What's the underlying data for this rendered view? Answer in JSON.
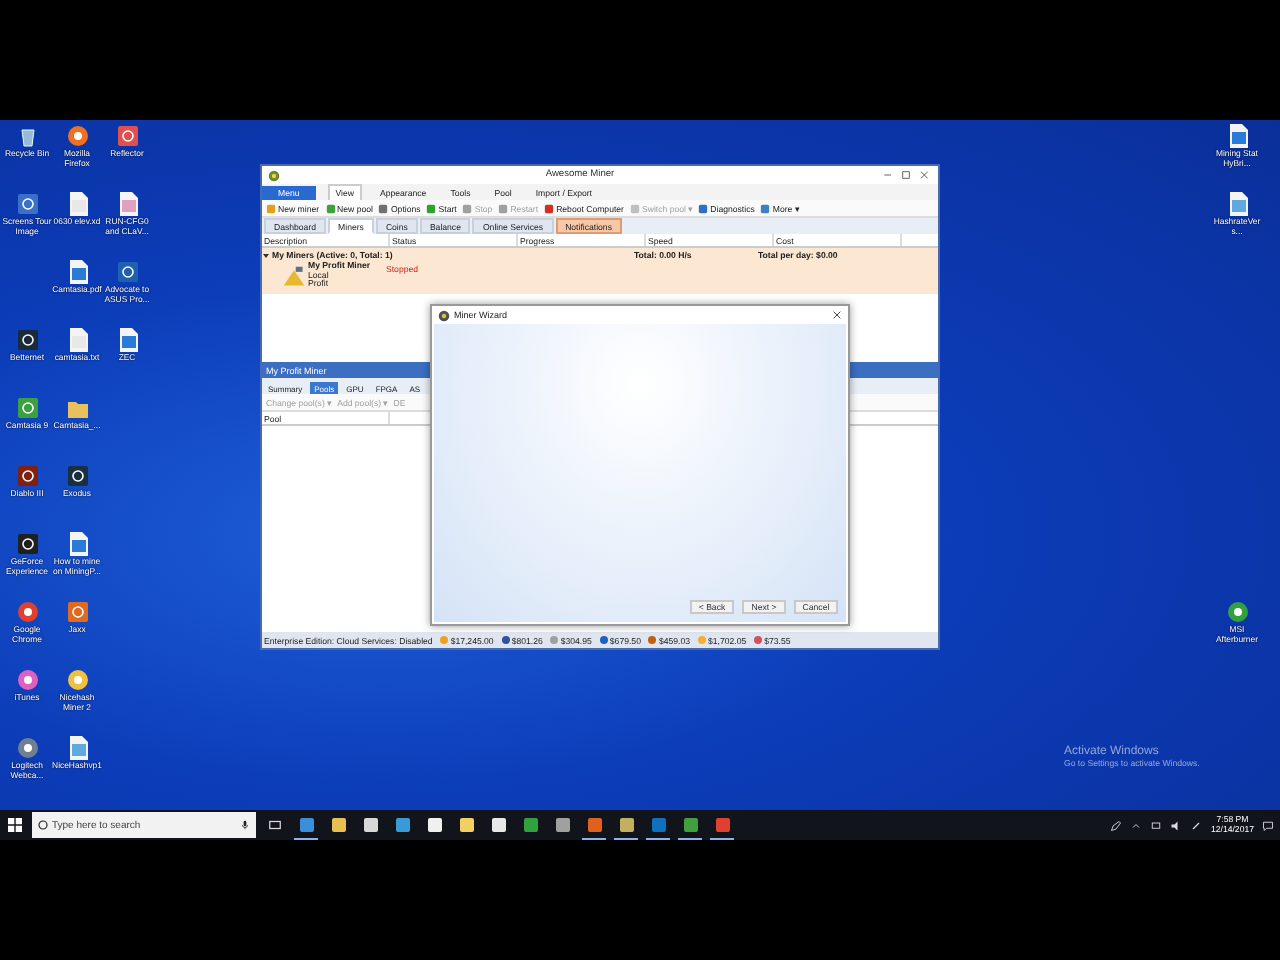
{
  "desktop": {
    "columns": [
      [
        {
          "label": "Recycle Bin",
          "kind": "bin",
          "color": "#9ab8d8"
        },
        {
          "label": "Screens Tour Image",
          "kind": "tile",
          "color": "#3a70c8"
        },
        {
          "label": "Betternet",
          "kind": "tile",
          "color": "#1a2a3a"
        },
        {
          "label": "Camtasia 9",
          "kind": "tile",
          "color": "#3aa040"
        },
        {
          "label": "Diablo III",
          "kind": "tile",
          "color": "#802010"
        },
        {
          "label": "GeForce Experience",
          "kind": "tile",
          "color": "#202020"
        },
        {
          "label": "Google Chrome",
          "kind": "globe",
          "color": "#e04030"
        },
        {
          "label": "iTunes",
          "kind": "globe",
          "color": "#e060c0"
        },
        {
          "label": "Logitech Webca...",
          "kind": "globe",
          "color": "#708090"
        }
      ],
      [
        {
          "label": "Mozilla Firefox",
          "kind": "globe",
          "color": "#f07020"
        },
        {
          "label": "0630 elev.xd",
          "kind": "page",
          "color": "#e8e8e8"
        },
        {
          "label": "Camtasia.pdf",
          "kind": "page",
          "color": "#2a7ad8"
        },
        {
          "label": "camtasia.txt",
          "kind": "page",
          "color": "#e8e8e8"
        },
        {
          "label": "Camtasia_...",
          "kind": "folder",
          "color": "#e8c060"
        },
        {
          "label": "Exodus",
          "kind": "tile",
          "color": "#183040"
        },
        {
          "label": "How to mine on MiningP...",
          "kind": "page",
          "color": "#2a7ad8"
        },
        {
          "label": "Jaxx",
          "kind": "tile",
          "color": "#e06a20"
        },
        {
          "label": "Nicehash Miner 2",
          "kind": "globe",
          "color": "#f0c040"
        },
        {
          "label": "NiceHashvp1",
          "kind": "page",
          "color": "#60a8e0"
        }
      ],
      [
        {
          "label": "Reflector",
          "kind": "tile",
          "color": "#e05050"
        },
        {
          "label": "RUN-CFG0 and CLaV...",
          "kind": "page",
          "color": "#e0a0c0"
        },
        {
          "label": "Advocate to ASUS Pro...",
          "kind": "tile",
          "color": "#2060b0"
        },
        {
          "label": "ZEC",
          "kind": "page",
          "color": "#2a7ad8"
        }
      ]
    ],
    "right_icons": [
      {
        "label": "Mining Stat HyBri...",
        "kind": "page",
        "color": "#2a7ad8"
      },
      {
        "label": "HashrateVers...",
        "kind": "page",
        "color": "#60a8e0"
      },
      {
        "label": "MSI Afterburner",
        "kind": "globe",
        "color": "#30a040"
      }
    ],
    "activation_notice": {
      "title": "Activate Windows",
      "text": "Go to Settings to activate Windows."
    }
  },
  "app_window": {
    "title": "Awesome Miner",
    "menu_button": "Menu",
    "ribbon_tabs": [
      {
        "label": "View",
        "selected": true
      },
      {
        "label": "Appearance",
        "selected": false
      },
      {
        "label": "Tools",
        "selected": false
      },
      {
        "label": "Pool",
        "selected": false
      },
      {
        "label": "Import / Export",
        "selected": false
      }
    ],
    "toolbar": [
      {
        "label": "New miner",
        "disabled": false,
        "color": "#e0a020"
      },
      {
        "label": "New pool",
        "disabled": false,
        "color": "#40a040"
      },
      {
        "label": "Options",
        "disabled": false,
        "color": "#707070"
      },
      {
        "label": "Start",
        "disabled": false,
        "color": "#30a030"
      },
      {
        "label": "Stop",
        "disabled": true,
        "color": "#a0a0a0"
      },
      {
        "label": "Restart",
        "disabled": true,
        "color": "#a0a0a0"
      },
      {
        "label": "Reboot Computer",
        "disabled": false,
        "color": "#d03020"
      },
      {
        "label": "Switch pool ▾",
        "disabled": true,
        "color": "#c0c0c0"
      },
      {
        "label": "Diagnostics",
        "disabled": false,
        "color": "#3070c0"
      },
      {
        "label": "More ▾",
        "disabled": false,
        "color": "#4080c0"
      }
    ],
    "tabs": [
      {
        "label": "Dashboard",
        "selected": false,
        "alert": false
      },
      {
        "label": "Miners",
        "selected": true,
        "alert": false
      },
      {
        "label": "Coins",
        "selected": false,
        "alert": false
      },
      {
        "label": "Balance",
        "selected": false,
        "alert": false
      },
      {
        "label": "Online Services",
        "selected": false,
        "alert": false
      },
      {
        "label": "Notifications",
        "selected": false,
        "alert": true
      }
    ],
    "columns": [
      "Description",
      "Status",
      "Progress",
      "Speed",
      "Cost"
    ],
    "group": {
      "expanded": true,
      "title": "My Miners (Active: 0, Total: 1)",
      "speed": "Total: 0.00 H/s",
      "cost": "Total per day: $0.00"
    },
    "miners": [
      {
        "name": "My Profit Miner",
        "lines": [
          "Local",
          "Profit"
        ],
        "status": "Stopped"
      }
    ],
    "detail": {
      "title": "My Profit Miner",
      "tabs": [
        {
          "label": "Summary",
          "selected": false
        },
        {
          "label": "Pools",
          "selected": true
        },
        {
          "label": "GPU",
          "selected": false
        },
        {
          "label": "FPGA",
          "selected": false
        },
        {
          "label": "AS",
          "selected": false
        }
      ],
      "toolbar": [
        {
          "label": "Change pool(s) ▾",
          "disabled": true
        },
        {
          "label": "Add pool(s) ▾",
          "disabled": true
        },
        {
          "label": "DE",
          "disabled": true
        }
      ],
      "columns": [
        "Pool"
      ]
    },
    "status_bar": {
      "edition": "Enterprise Edition: Cloud Services: Disabled",
      "prices": [
        {
          "value": "$17,245.00",
          "color": "#f0a020"
        },
        {
          "value": "$801.26",
          "color": "#3050a0"
        },
        {
          "value": "$304.95",
          "color": "#a0a0a0"
        },
        {
          "value": "$679.50",
          "color": "#2060c0"
        },
        {
          "value": "$459.03",
          "color": "#c06010"
        },
        {
          "value": "$1,702.05",
          "color": "#f0b030"
        },
        {
          "value": "$73.55",
          "color": "#d05060"
        }
      ]
    }
  },
  "wizard": {
    "title": "Miner Wizard",
    "buttons": [
      "< Back",
      "Next >",
      "Cancel"
    ]
  },
  "taskbar": {
    "search": {
      "placeholder": "Type here to search"
    },
    "apps": [
      {
        "color": "#3a8fd8",
        "running": true
      },
      {
        "color": "#e8c050",
        "running": false
      },
      {
        "color": "#d8d8d8",
        "running": false
      },
      {
        "color": "#3a9ad8",
        "running": false
      },
      {
        "color": "#f0f0f0",
        "running": false
      },
      {
        "color": "#f0d060",
        "running": false
      },
      {
        "color": "#e8e8e8",
        "running": false
      },
      {
        "color": "#30a040",
        "running": false
      },
      {
        "color": "#a0a0a0",
        "running": false
      },
      {
        "color": "#e06020",
        "running": true
      },
      {
        "color": "#c0b060",
        "running": true
      },
      {
        "color": "#1070c0",
        "running": true
      },
      {
        "color": "#40a040",
        "running": true
      },
      {
        "color": "#e04030",
        "running": true
      }
    ],
    "time": "7:58 PM",
    "date": "12/14/2017"
  }
}
